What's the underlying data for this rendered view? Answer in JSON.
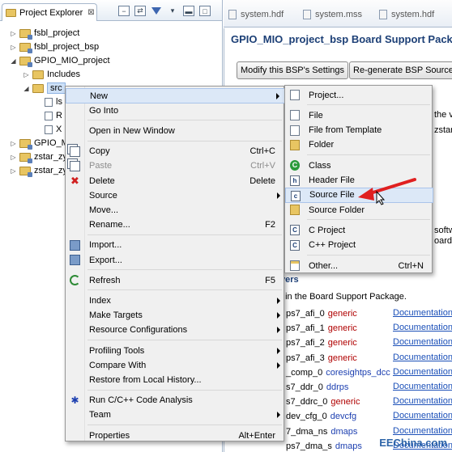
{
  "left_panel": {
    "tab_title": "Project Explorer",
    "tab_close": "⊠",
    "tree": [
      {
        "label": "fsbl_project",
        "level": 0,
        "twisty": "▷"
      },
      {
        "label": "fsbl_project_bsp",
        "level": 0,
        "twisty": "▷"
      },
      {
        "label": "GPIO_MIO_project",
        "level": 0,
        "twisty": "◢"
      },
      {
        "label": "Includes",
        "level": 1,
        "twisty": "▷"
      },
      {
        "label": "src",
        "level": 1,
        "twisty": "◢"
      },
      {
        "label": "ls",
        "level": 2,
        "twisty": ""
      },
      {
        "label": "R",
        "level": 2,
        "twisty": ""
      },
      {
        "label": "X",
        "level": 2,
        "twisty": ""
      },
      {
        "label": "GPIO_M",
        "level": 0,
        "twisty": "▷"
      },
      {
        "label": "zstar_zy",
        "level": 0,
        "twisty": "▷"
      },
      {
        "label": "zstar_zy",
        "level": 0,
        "twisty": "▷"
      }
    ]
  },
  "editor": {
    "tabs": [
      "system.hdf",
      "system.mss",
      "system.hdf"
    ],
    "title": "GPIO_MIO_project_bsp Board Support Packa",
    "buttons": [
      "Modify this BSP's Settings",
      "Re-generate BSP Sources"
    ],
    "side_fragments": [
      "the v",
      "zstar_z",
      "softw",
      "oard"
    ],
    "drivers_header": "vers",
    "drivers_desc": "t in the Board Support Package.",
    "drivers": [
      {
        "name": "ps7_afi_0",
        "driver": "generic",
        "doc": "Documentation"
      },
      {
        "name": "ps7_afi_1",
        "driver": "generic",
        "doc": "Documentation"
      },
      {
        "name": "ps7_afi_2",
        "driver": "generic",
        "doc": "Documentation"
      },
      {
        "name": "ps7_afi_3",
        "driver": "generic",
        "doc": "Documentation"
      },
      {
        "name": "_comp_0",
        "driver": "coresightps_dcc",
        "doc": "Documentation"
      },
      {
        "name": "s7_ddr_0",
        "driver": "ddrps",
        "doc": "Documentation"
      },
      {
        "name": "s7_ddrc_0",
        "driver": "generic",
        "doc": "Documentation"
      },
      {
        "name": "dev_cfg_0",
        "driver": "devcfg",
        "doc": "Documentation"
      },
      {
        "name": "7_dma_ns",
        "driver": "dmaps",
        "doc": "Documentation"
      },
      {
        "name": "ps7_dma_s",
        "driver": "dmaps",
        "doc": "Documentation"
      }
    ]
  },
  "context_menu": {
    "items": [
      {
        "label": "New",
        "shortcut": "",
        "submenu": true,
        "icon": "",
        "highlight": true
      },
      {
        "label": "Go Into",
        "shortcut": "",
        "icon": ""
      },
      {
        "sep": true
      },
      {
        "label": "Open in New Window",
        "shortcut": "",
        "icon": ""
      },
      {
        "sep": true
      },
      {
        "label": "Copy",
        "shortcut": "Ctrl+C",
        "icon": "copy-icon"
      },
      {
        "label": "Paste",
        "shortcut": "Ctrl+V",
        "icon": "paste-icon",
        "disabled": true
      },
      {
        "label": "Delete",
        "shortcut": "Delete",
        "icon": "delete-icon"
      },
      {
        "label": "Source",
        "shortcut": "",
        "submenu": true,
        "icon": ""
      },
      {
        "label": "Move...",
        "shortcut": "",
        "icon": ""
      },
      {
        "label": "Rename...",
        "shortcut": "F2",
        "icon": ""
      },
      {
        "sep": true
      },
      {
        "label": "Import...",
        "shortcut": "",
        "icon": "import-icon"
      },
      {
        "label": "Export...",
        "shortcut": "",
        "icon": "export-icon"
      },
      {
        "sep": true
      },
      {
        "label": "Refresh",
        "shortcut": "F5",
        "icon": "refresh-icon"
      },
      {
        "sep": true
      },
      {
        "label": "Index",
        "shortcut": "",
        "submenu": true,
        "icon": ""
      },
      {
        "label": "Make Targets",
        "shortcut": "",
        "submenu": true,
        "icon": ""
      },
      {
        "label": "Resource Configurations",
        "shortcut": "",
        "submenu": true,
        "icon": ""
      },
      {
        "sep": true
      },
      {
        "label": "Profiling Tools",
        "shortcut": "",
        "submenu": true,
        "icon": ""
      },
      {
        "label": "Compare With",
        "shortcut": "",
        "submenu": true,
        "icon": ""
      },
      {
        "label": "Restore from Local History...",
        "shortcut": "",
        "icon": ""
      },
      {
        "sep": true
      },
      {
        "label": "Run C/C++ Code Analysis",
        "shortcut": "",
        "icon": "analysis-icon"
      },
      {
        "label": "Team",
        "shortcut": "",
        "submenu": true,
        "icon": ""
      },
      {
        "sep": true
      },
      {
        "label": "Properties",
        "shortcut": "Alt+Enter",
        "icon": ""
      }
    ]
  },
  "submenu": {
    "items": [
      {
        "label": "Project...",
        "shortcut": "",
        "icon": "project-icon"
      },
      {
        "sep": true
      },
      {
        "label": "File",
        "shortcut": "",
        "icon": "file-icon"
      },
      {
        "label": "File from Template",
        "shortcut": "",
        "icon": "file-template-icon"
      },
      {
        "label": "Folder",
        "shortcut": "",
        "icon": "folder-icon"
      },
      {
        "sep": true
      },
      {
        "label": "Class",
        "shortcut": "",
        "icon": "class-icon"
      },
      {
        "label": "Header File",
        "shortcut": "",
        "icon": "header-file-icon"
      },
      {
        "label": "Source File",
        "shortcut": "",
        "icon": "source-file-icon",
        "highlight": true
      },
      {
        "label": "Source Folder",
        "shortcut": "",
        "icon": "source-folder-icon"
      },
      {
        "sep": true
      },
      {
        "label": "C Project",
        "shortcut": "",
        "icon": "c-project-icon"
      },
      {
        "label": "C++ Project",
        "shortcut": "",
        "icon": "cpp-project-icon"
      },
      {
        "sep": true
      },
      {
        "label": "Other...",
        "shortcut": "Ctrl+N",
        "icon": "other-icon"
      }
    ]
  },
  "watermark": "EEChina.com",
  "colors": {
    "accent": "#1c3f76",
    "link": "#1a4fb8",
    "driver_red": "#b00000",
    "arrow_red": "#e02020"
  }
}
